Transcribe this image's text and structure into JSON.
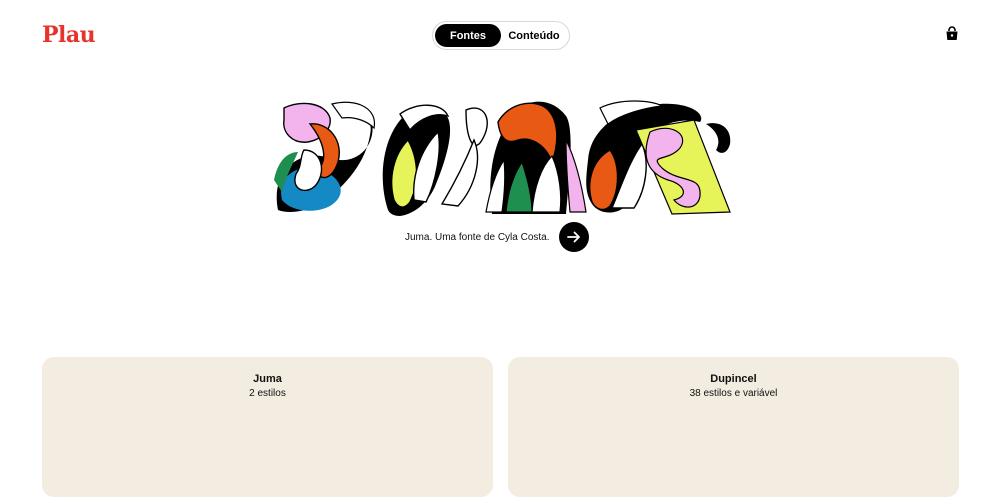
{
  "brand": {
    "logo_text": "Plau",
    "logo_color": "#e8332d"
  },
  "nav": {
    "tabs": [
      {
        "label": "Fontes",
        "active": true
      },
      {
        "label": "Conteúdo",
        "active": false
      }
    ]
  },
  "header": {
    "cart_icon": "shopping-bag-icon"
  },
  "hero": {
    "artwork_text": "Juma",
    "caption": "Juma. Uma fonte de Cyla Costa.",
    "cta_icon": "arrow-right-icon",
    "palette": [
      "#f3b3ec",
      "#e85a14",
      "#1f8f4f",
      "#1589c4",
      "#e6f45a",
      "#000000",
      "#ffffff"
    ]
  },
  "cards": [
    {
      "title": "Juma",
      "subtitle": "2 estilos"
    },
    {
      "title": "Dupincel",
      "subtitle": "38 estilos e variável"
    }
  ],
  "colors": {
    "card_bg": "#f3ece0",
    "accent": "#e8332d"
  }
}
